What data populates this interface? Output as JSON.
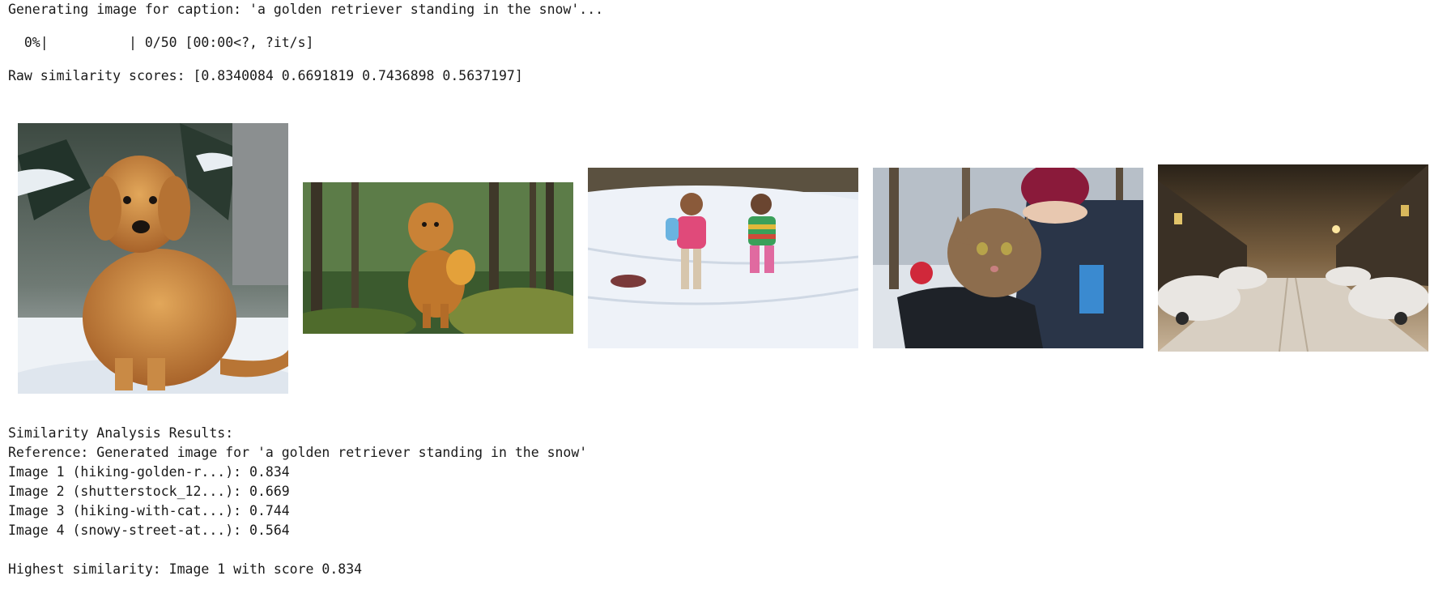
{
  "output": {
    "caption_line": "Generating image for caption: 'a golden retriever standing in the snow'...",
    "progress_line": "  0%|          | 0/50 [00:00<?, ?it/s]",
    "raw_scores_line": "Raw similarity scores: [0.8340084 0.6691819 0.7436898 0.5637197]",
    "results_header": "Similarity Analysis Results:",
    "reference_line": "Reference: Generated image for 'a golden retriever standing in the snow'",
    "results": [
      "Image 1 (hiking-golden-r...): 0.834",
      "Image 2 (shutterstock_12...): 0.669",
      "Image 3 (hiking-with-cat...): 0.744",
      "Image 4 (snowy-street-at...): 0.564"
    ],
    "highest_line": "Highest similarity: Image 1 with score 0.834"
  },
  "images": [
    {
      "subject": "golden retriever sitting in snow"
    },
    {
      "subject": "golden retriever with backpack in forest"
    },
    {
      "subject": "two children running in snow"
    },
    {
      "subject": "cat in backpack on hiker in snow"
    },
    {
      "subject": "snowy street at night with parked cars"
    }
  ],
  "colors": {
    "text": "#1a1a1a",
    "background": "#ffffff"
  }
}
